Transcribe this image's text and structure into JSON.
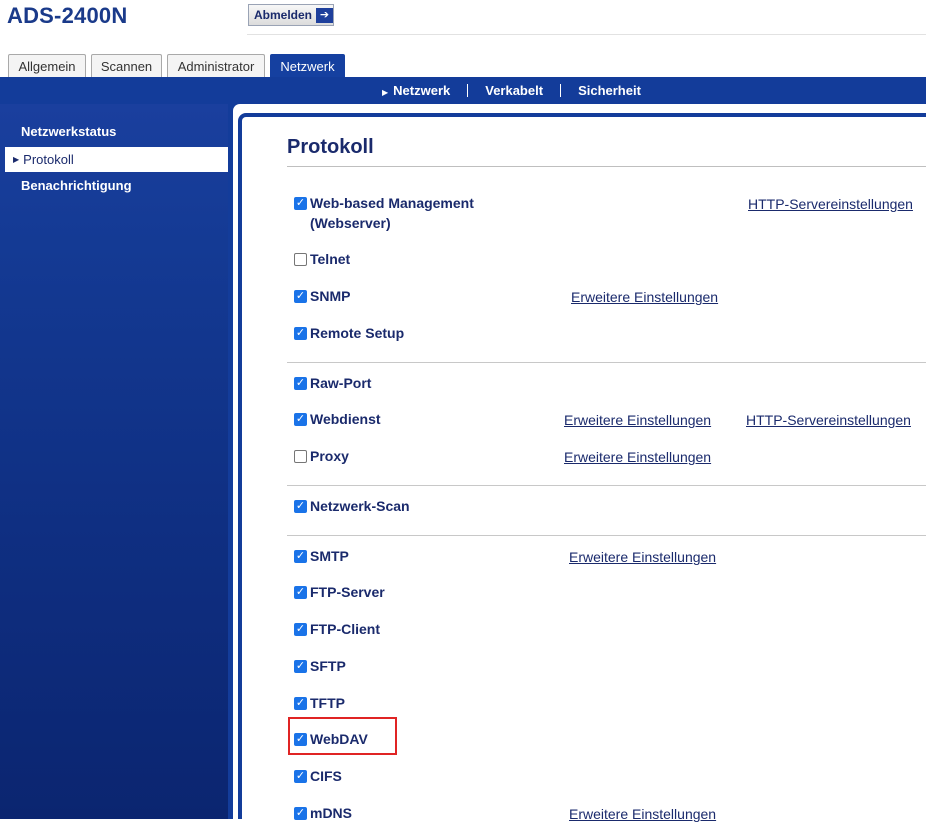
{
  "header": {
    "model": "ADS-2400N",
    "logout_label": "Abmelden",
    "logout_icon": "arrow-right-icon"
  },
  "tabs": [
    {
      "label": "Allgemein",
      "active": false
    },
    {
      "label": "Scannen",
      "active": false
    },
    {
      "label": "Administrator",
      "active": false
    },
    {
      "label": "Netzwerk",
      "active": true
    }
  ],
  "subnav": {
    "items": [
      {
        "label": "Netzwerk",
        "active": true
      },
      {
        "label": "Verkabelt",
        "active": false
      },
      {
        "label": "Sicherheit",
        "active": false
      }
    ]
  },
  "sidebar": {
    "items": [
      {
        "label": "Netzwerkstatus",
        "active": false
      },
      {
        "label": "Protokoll",
        "active": true
      },
      {
        "label": "Benachrichtigung",
        "active": false
      }
    ]
  },
  "main": {
    "title": "Protokoll",
    "protocols": [
      {
        "label": "Web-based Management (Webserver)",
        "checked": true,
        "links": [
          "HTTP-Servereinstellungen"
        ]
      },
      {
        "label": "Telnet",
        "checked": false,
        "links": []
      },
      {
        "label": "SNMP",
        "checked": true,
        "links": [
          "Erweitere Einstellungen"
        ]
      },
      {
        "label": "Remote Setup",
        "checked": true,
        "links": []
      },
      {
        "label": "Raw-Port",
        "checked": true,
        "links": []
      },
      {
        "label": "Webdienst",
        "checked": true,
        "links": [
          "Erweitere Einstellungen",
          "HTTP-Servereinstellungen"
        ]
      },
      {
        "label": "Proxy",
        "checked": false,
        "links": [
          "Erweitere Einstellungen"
        ]
      },
      {
        "label": "Netzwerk-Scan",
        "checked": true,
        "links": []
      },
      {
        "label": "SMTP",
        "checked": true,
        "links": [
          "Erweitere Einstellungen"
        ]
      },
      {
        "label": "FTP-Server",
        "checked": true,
        "links": []
      },
      {
        "label": "FTP-Client",
        "checked": true,
        "links": []
      },
      {
        "label": "SFTP",
        "checked": true,
        "links": []
      },
      {
        "label": "TFTP",
        "checked": true,
        "links": []
      },
      {
        "label": "WebDAV",
        "checked": true,
        "links": []
      },
      {
        "label": "CIFS",
        "checked": true,
        "links": []
      },
      {
        "label": "mDNS",
        "checked": true,
        "links": [
          "Erweitere Einstellungen"
        ]
      }
    ]
  },
  "colors": {
    "brand_blue": "#133c9a",
    "text_navy": "#1a2a6c",
    "checkbox_blue": "#1a73e8",
    "highlight_red": "#e02424"
  }
}
